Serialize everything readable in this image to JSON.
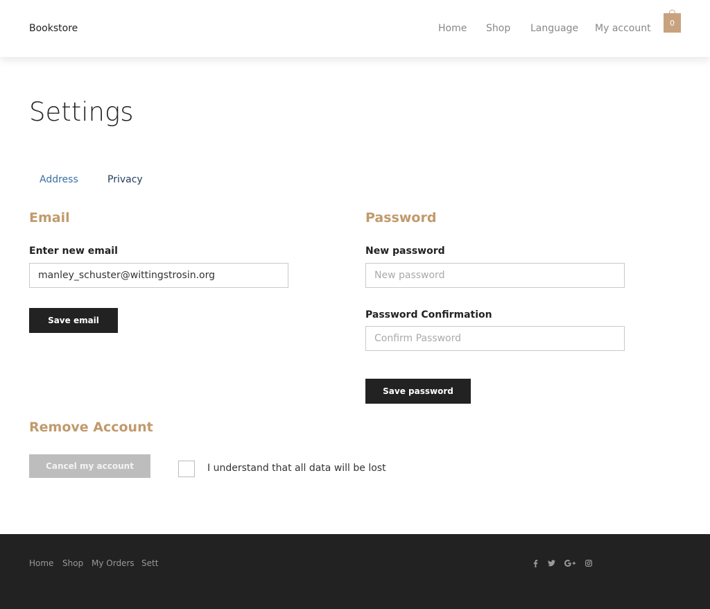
{
  "header": {
    "brand": "Bookstore",
    "nav": [
      "Home",
      "Shop",
      "Language",
      "My account"
    ],
    "cart_count": "0"
  },
  "page": {
    "title": "Settings",
    "tabs": [
      "Address",
      "Privacy"
    ]
  },
  "email_section": {
    "title": "Email",
    "label": "Enter new email",
    "value": "manley_schuster@wittingstrosin.org",
    "save_label": "Save email"
  },
  "password_section": {
    "title": "Password",
    "new_label": "New password",
    "new_placeholder": "New password",
    "confirm_label": "Password Confirmation",
    "confirm_placeholder": "Confirm Password",
    "save_label": "Save password"
  },
  "remove_section": {
    "title": "Remove Account",
    "cancel_label": "Cancel my account",
    "checkbox_label": "I understand that all data will be lost"
  },
  "footer": {
    "links": [
      "Home",
      "Shop",
      "My Orders",
      "Sett"
    ],
    "social": [
      "facebook-icon",
      "twitter-icon",
      "google-plus-icon",
      "instagram-icon"
    ]
  },
  "colors": {
    "accent": "#c19a6b",
    "cart": "#c8a27e",
    "footer_bg": "#222222",
    "button_dark": "#222222",
    "button_disabled": "#bdbdbd"
  }
}
